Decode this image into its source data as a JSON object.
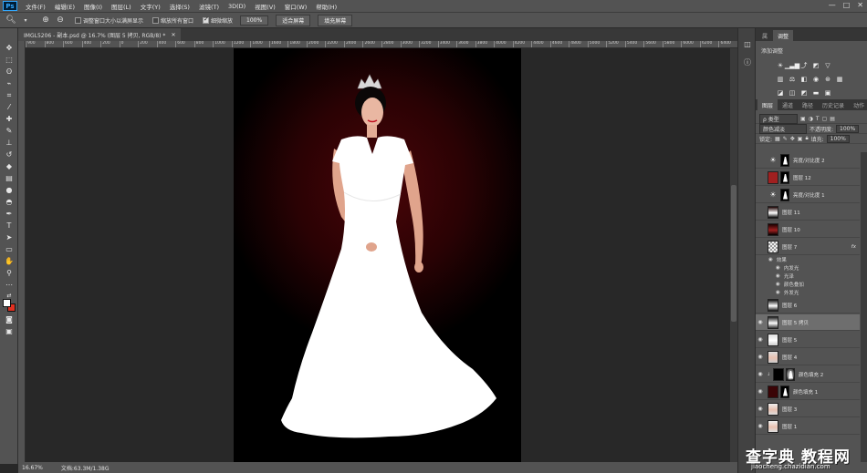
{
  "app": {
    "logo": "Ps"
  },
  "menubar": {
    "items": [
      "文件(F)",
      "编辑(E)",
      "图像(I)",
      "图层(L)",
      "文字(Y)",
      "选择(S)",
      "滤镜(T)",
      "3D(D)",
      "视图(V)",
      "窗口(W)",
      "帮助(H)"
    ],
    "window_controls": [
      "—",
      "□",
      "✕"
    ]
  },
  "options_bar": {
    "tool_icon": "zoom-icon",
    "zoom_in_icon": "zoom-in-icon",
    "zoom_out_icon": "zoom-out-icon",
    "resize_windows": {
      "label": "调整窗口大小以满屏显示",
      "checked": false
    },
    "zoom_all_windows": {
      "label": "缩放所有窗口",
      "checked": false
    },
    "scrubby_zoom": {
      "label": "细微缩放",
      "checked": true
    },
    "zoom_percent_button": "100%",
    "fit_screen_button": "适合屏幕",
    "fill_screen_button": "填充屏幕"
  },
  "document": {
    "tab_title": "IMGL5206 - 副本.psd @ 16.7% (图层 5 拷贝, RGB/8) *",
    "zoom": "16.67%",
    "doc_size": "文档:63.3M/1.38G"
  },
  "ruler": {
    "marks": [
      "900",
      "800",
      "600",
      "400",
      "200",
      "0",
      "200",
      "400",
      "600",
      "800",
      "1000",
      "1200",
      "1400",
      "1600",
      "1800",
      "2000",
      "2200",
      "2400",
      "2600",
      "2800",
      "3000",
      "3200",
      "3400",
      "3600",
      "3800",
      "4000",
      "4200",
      "4400",
      "4600",
      "4800",
      "5000",
      "5200",
      "5400",
      "5600",
      "5800",
      "6000",
      "6200",
      "6400"
    ]
  },
  "panels": {
    "properties_tabs": [
      "属",
      "调整"
    ],
    "adjustments_title": "添加调整",
    "layers_tabs": [
      "图层",
      "通道",
      "路径",
      "历史记录",
      "动作"
    ],
    "kind_filter": "ρ 类型",
    "blend_mode": "颜色减淡",
    "opacity_label": "不透明度:",
    "opacity_value": "100%",
    "lock_label": "锁定:",
    "fill_label": "填充:",
    "fill_value": "100%",
    "layers": [
      {
        "name": "亮度/对比度 2",
        "visible": false,
        "kind": "adjustment"
      },
      {
        "name": "图层 12",
        "visible": false,
        "kind": "masked"
      },
      {
        "name": "亮度/对比度 1",
        "visible": false,
        "kind": "adjustment"
      },
      {
        "name": "图层 11",
        "visible": false,
        "kind": "pixel"
      },
      {
        "name": "图层 10",
        "visible": false,
        "kind": "pixel"
      },
      {
        "name": "图层 7",
        "visible": false,
        "kind": "pixel",
        "fx": "fx"
      },
      {
        "name": "图层 6",
        "visible": false,
        "kind": "pixel"
      },
      {
        "name": "图层 5 拷贝",
        "visible": true,
        "kind": "pixel",
        "selected": true
      },
      {
        "name": "图层 5",
        "visible": true,
        "kind": "pixel"
      },
      {
        "name": "图层 4",
        "visible": true,
        "kind": "pixel"
      },
      {
        "name": "颜色填充 2",
        "visible": true,
        "kind": "fill"
      },
      {
        "name": "颜色填充 1",
        "visible": true,
        "kind": "fill-red"
      },
      {
        "name": "图层 3",
        "visible": true,
        "kind": "pixel"
      },
      {
        "name": "图层 1",
        "visible": true,
        "kind": "pixel"
      }
    ],
    "effects_label": "效果",
    "effects": [
      "内发光",
      "光泽",
      "颜色叠加",
      "外发光"
    ]
  },
  "watermark": {
    "main": "查字典 教程网",
    "sub": "jiaocheng.chazidian.com"
  },
  "colors": {
    "accent": "#31a8ff",
    "foreground": "#ffffff",
    "background": "#e03020"
  }
}
